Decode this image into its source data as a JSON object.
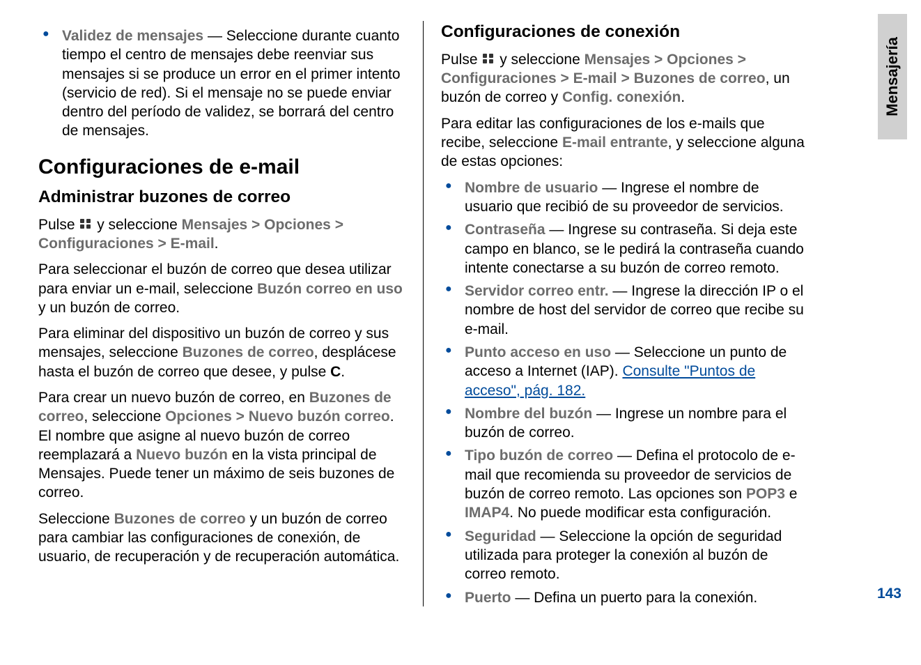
{
  "sideTab": "Mensajería",
  "pageNumber": "143",
  "left": {
    "bullet1": {
      "term": "Validez de mensajes",
      "text": " — Seleccione durante cuanto tiempo el centro de mensajes debe reenviar sus mensajes si se produce un error en el primer intento (servicio de red). Si el mensaje no se puede enviar dentro del período de validez, se borrará del centro de mensajes."
    },
    "h2": "Configuraciones de e-mail",
    "h3": "Administrar buzones de correo",
    "p1a": "Pulse ",
    "p1b": " y seleccione ",
    "nav1_1": "Mensajes",
    "nav1_2": "Opciones",
    "nav1_3": "Configuraciones",
    "nav1_4": "E-mail",
    "p2a": "Para seleccionar el buzón de correo que desea utilizar para enviar un e-mail, seleccione ",
    "p2term": "Buzón correo en uso",
    "p2b": " y un buzón de correo.",
    "p3a": "Para eliminar del dispositivo un buzón de correo y sus mensajes, seleccione ",
    "p3term": "Buzones de correo",
    "p3b": ", desplácese hasta el buzón de correo que desee, y pulse ",
    "p3key": "C",
    "p4a": "Para crear un nuevo buzón de correo, en ",
    "p4term1": "Buzones de correo",
    "p4b": ", seleccione ",
    "p4term2": "Opciones",
    "p4term3": "Nuevo buzón correo",
    "p4c": ". El nombre que asigne al nuevo buzón de correo reemplazará a ",
    "p4term4": "Nuevo buzón",
    "p4d": " en la vista principal de Mensajes. Puede tener un máximo de seis buzones de correo.",
    "p5a": "Seleccione ",
    "p5term": "Buzones de correo",
    "p5b": " y un buzón de correo para cambiar las configuraciones de conexión, de usuario, de recuperación y de recuperación automática."
  },
  "right": {
    "h3": "Configuraciones de conexión",
    "p1a": "Pulse ",
    "p1b": " y seleccione ",
    "nav_1": "Mensajes",
    "nav_2": "Opciones",
    "nav_3": "Configuraciones",
    "nav_4": "E-mail",
    "nav_5": "Buzones de correo",
    "p1c": ", un buzón de correo y ",
    "nav_6": "Config. conexión",
    "p2a": "Para editar las configuraciones de los e-mails que recibe, seleccione ",
    "p2term": "E-mail entrante",
    "p2b": ", y seleccione alguna de estas opciones:",
    "items": [
      {
        "term": "Nombre de usuario",
        "text": " — Ingrese el nombre de usuario que recibió de su proveedor de servicios."
      },
      {
        "term": "Contraseña",
        "text": " — Ingrese su contraseña. Si deja este campo en blanco, se le pedirá la contraseña cuando intente conectarse a su buzón de correo remoto."
      },
      {
        "term": "Servidor correo entr.",
        "text": " — Ingrese la dirección IP o el nombre de host del servidor de correo que recibe su e-mail."
      },
      {
        "term": "Punto acceso en uso",
        "text": " — Seleccione un punto de acceso a Internet (IAP). ",
        "link": "Consulte \"Puntos de acceso\", pág. 182."
      },
      {
        "term": "Nombre del buzón",
        "text": " — Ingrese un nombre para el buzón de correo."
      }
    ],
    "item6": {
      "term": "Tipo buzón de correo",
      "text1": " — Defina el protocolo de e-mail que recomienda su proveedor de servicios de buzón de correo remoto. Las opciones son ",
      "opt1": "POP3",
      "mid": " e ",
      "opt2": "IMAP4",
      "text2": ". No puede modificar esta configuración."
    },
    "item7": {
      "term": "Seguridad",
      "text": " — Seleccione la opción de seguridad utilizada para proteger la conexión al buzón de correo remoto."
    },
    "item8": {
      "term": "Puerto",
      "text": " — Defina un puerto para la conexión."
    }
  }
}
